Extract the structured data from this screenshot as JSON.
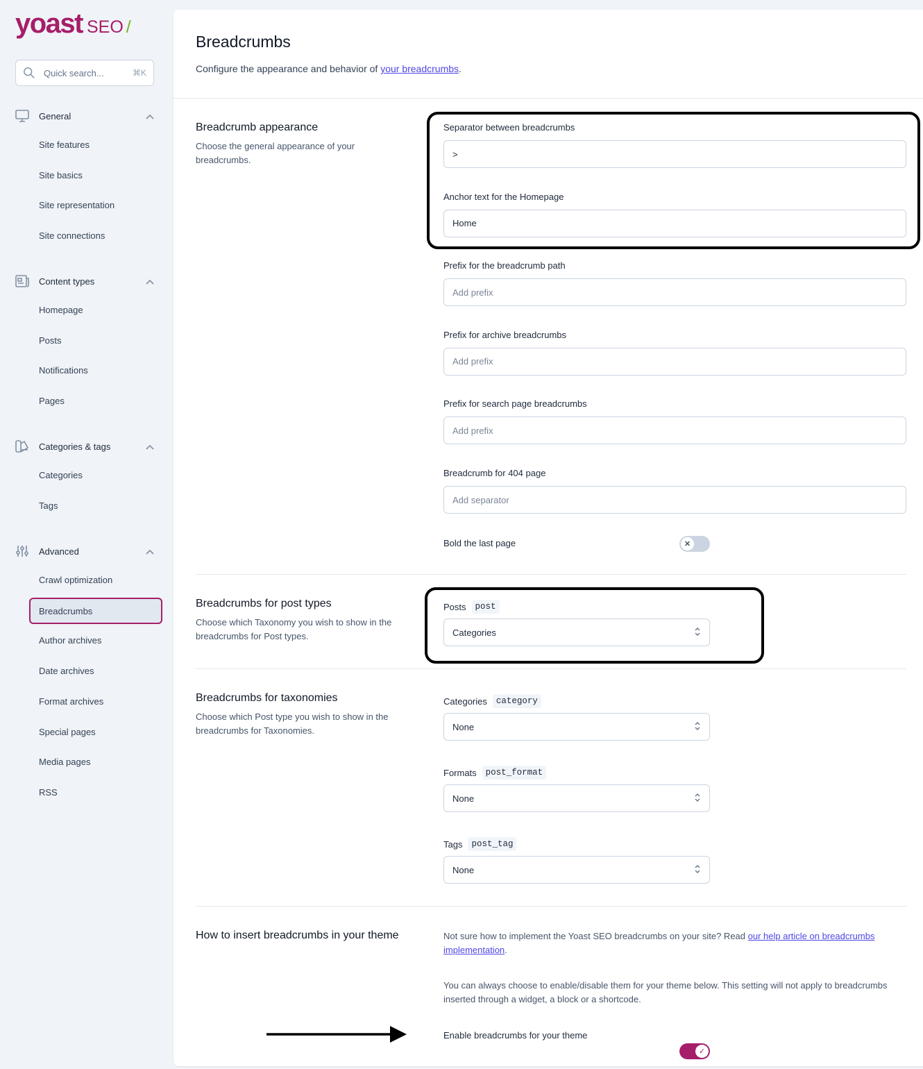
{
  "brand": {
    "logo": "yoast",
    "logo_suffix": "SEO",
    "accent": "#a61e69"
  },
  "search": {
    "placeholder": "Quick search...",
    "shortcut": "⌘K",
    "icon": "search-icon"
  },
  "sidebar": {
    "groups": [
      {
        "label": "General",
        "icon": "monitor-icon",
        "items": [
          "Site features",
          "Site basics",
          "Site representation",
          "Site connections"
        ]
      },
      {
        "label": "Content types",
        "icon": "newspaper-icon",
        "items": [
          "Homepage",
          "Posts",
          "Notifications",
          "Pages"
        ]
      },
      {
        "label": "Categories & tags",
        "icon": "tag-color-icon",
        "items": [
          "Categories",
          "Tags"
        ]
      },
      {
        "label": "Advanced",
        "icon": "adjustments-icon",
        "items": [
          "Crawl optimization",
          "Breadcrumbs",
          "Author archives",
          "Date archives",
          "Format archives",
          "Special pages",
          "Media pages",
          "RSS"
        ]
      }
    ],
    "active": "Breadcrumbs"
  },
  "header": {
    "title": "Breadcrumbs",
    "desc_before": "Configure the appearance and behavior of ",
    "desc_link": "your breadcrumbs",
    "desc_after": "."
  },
  "appearance": {
    "title": "Breadcrumb appearance",
    "desc": "Choose the general appearance of your breadcrumbs.",
    "fields": [
      {
        "label": "Separator between breadcrumbs",
        "value": ">",
        "placeholder": ""
      },
      {
        "label": "Anchor text for the Homepage",
        "value": "Home",
        "placeholder": ""
      },
      {
        "label": "Prefix for the breadcrumb path",
        "value": "",
        "placeholder": "Add prefix"
      },
      {
        "label": "Prefix for archive breadcrumbs",
        "value": "",
        "placeholder": "Add prefix"
      },
      {
        "label": "Prefix for search page breadcrumbs",
        "value": "",
        "placeholder": "Add prefix"
      },
      {
        "label": "Breadcrumb for 404 page",
        "value": "",
        "placeholder": "Add separator"
      }
    ],
    "bold_label": "Bold the last page",
    "bold_on": false
  },
  "post_types": {
    "title": "Breadcrumbs for post types",
    "desc": "Choose which Taxonomy you wish to show in the breadcrumbs for Post types.",
    "fields": [
      {
        "label": "Posts",
        "code": "post",
        "value": "Categories"
      }
    ]
  },
  "taxonomies": {
    "title": "Breadcrumbs for taxonomies",
    "desc": "Choose which Post type you wish to show in the breadcrumbs for Taxonomies.",
    "fields": [
      {
        "label": "Categories",
        "code": "category",
        "value": "None"
      },
      {
        "label": "Formats",
        "code": "post_format",
        "value": "None"
      },
      {
        "label": "Tags",
        "code": "post_tag",
        "value": "None"
      }
    ]
  },
  "theme": {
    "title": "How to insert breadcrumbs in your theme",
    "p1_before": "Not sure how to implement the Yoast SEO breadcrumbs on your site? Read ",
    "p1_link": "our help article on breadcrumbs implementation",
    "p1_after": ".",
    "p2": "You can always choose to enable/disable them for your theme below. This setting will not apply to breadcrumbs inserted through a widget, a block or a shortcode.",
    "enable_label": "Enable breadcrumbs for your theme",
    "enable_on": true
  }
}
